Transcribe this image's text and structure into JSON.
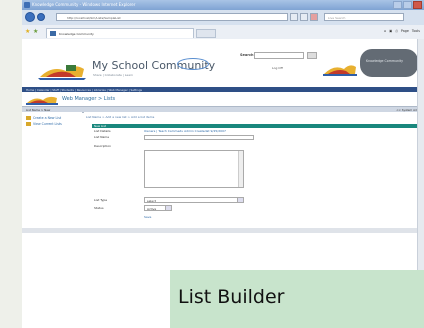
{
  "browser": {
    "window_title": "Knowledge Community - Windows Internet Explorer",
    "address": "http://localhost/km/Lists/SampleList",
    "live_search_placeholder": "Live Search",
    "tab_title": "Knowledge Community",
    "tools": [
      "Page",
      "Tools"
    ]
  },
  "site": {
    "name": "My School Community",
    "subtitle": "Share | Collaborate | Learn",
    "search_label": "Search",
    "logoff": "Log Off",
    "badge": "Knowledge Community",
    "menu_text": "Home | Calendar | Staff | Students | Resources | Libraries | Web Manager | Settings"
  },
  "webmanager": {
    "title": "Web Manager > Lists",
    "crumb_left": "List Name > New",
    "crumb_right": "<< System Admin"
  },
  "sidebar": {
    "items": [
      {
        "label": "Create a New List",
        "icon": "folder-icon"
      },
      {
        "label": "View Current Lists",
        "icon": "folder-icon"
      }
    ]
  },
  "form": {
    "breadcrumb": "List Name > Add a new list > Add a list items",
    "header": "New List",
    "list_details_label": "List Details",
    "list_details_value": "Owners | Teach Cammedu Admin Createdat 9/25/2007",
    "list_name_label": "List Name",
    "description_label": "Description",
    "list_type_label": "List Type",
    "list_type_value": "select",
    "status_label": "Status",
    "status_value": "Active",
    "save_label": "Save"
  },
  "caption": {
    "text": "List Builder"
  },
  "colors": {
    "form_header": "#19877d",
    "menu_bar": "#2e4f86",
    "caption_bg": "#c8e4cc"
  }
}
